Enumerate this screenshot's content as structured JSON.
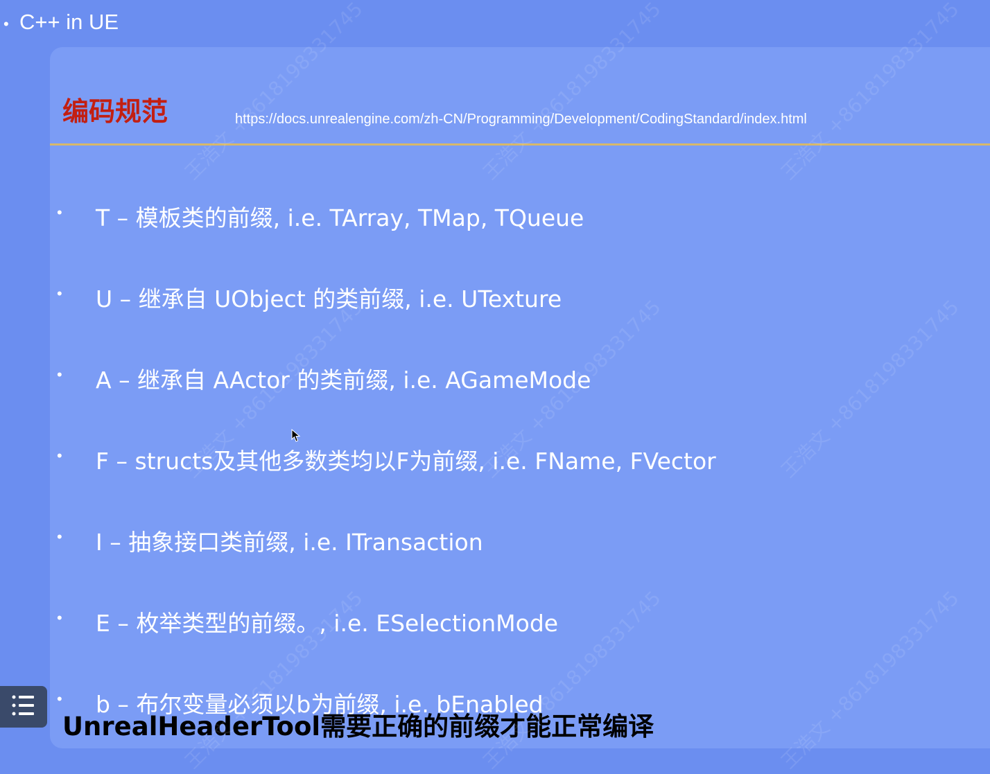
{
  "top_bar": {
    "bullet": "•",
    "title": "C++ in UE"
  },
  "slide": {
    "heading": "编码规范",
    "link": "https://docs.unrealengine.com/zh-CN/Programming/Development/CodingStandard/index.html",
    "bullets": [
      "T – 模板类的前缀, i.e. TArray, TMap, TQueue",
      "U – 继承自 UObject 的类前缀, i.e. UTexture",
      "A – 继承自 AActor 的类前缀, i.e. AGameMode",
      "F – structs及其他多数类均以F为前缀, i.e. FName, FVector",
      "I – 抽象接口类前缀, i.e. ITransaction",
      "E – 枚举类型的前缀。, i.e. ESelectionMode",
      "b – 布尔变量必须以b为前缀, i.e. bEnabled"
    ],
    "bullet_marker": "•",
    "bottom_note": "UnrealHeaderTool需要正确的前缀才能正常编译"
  },
  "watermark": "王浩文 +8618198331745",
  "icons": {
    "toc": "list-icon",
    "cursor": "mouse-pointer-icon"
  },
  "colors": {
    "background": "#6b8ef0",
    "slide_background": "#7b9cf5",
    "heading": "#c21f12",
    "divider": "#d7b86a",
    "toc_button": "#3a4a6a"
  }
}
